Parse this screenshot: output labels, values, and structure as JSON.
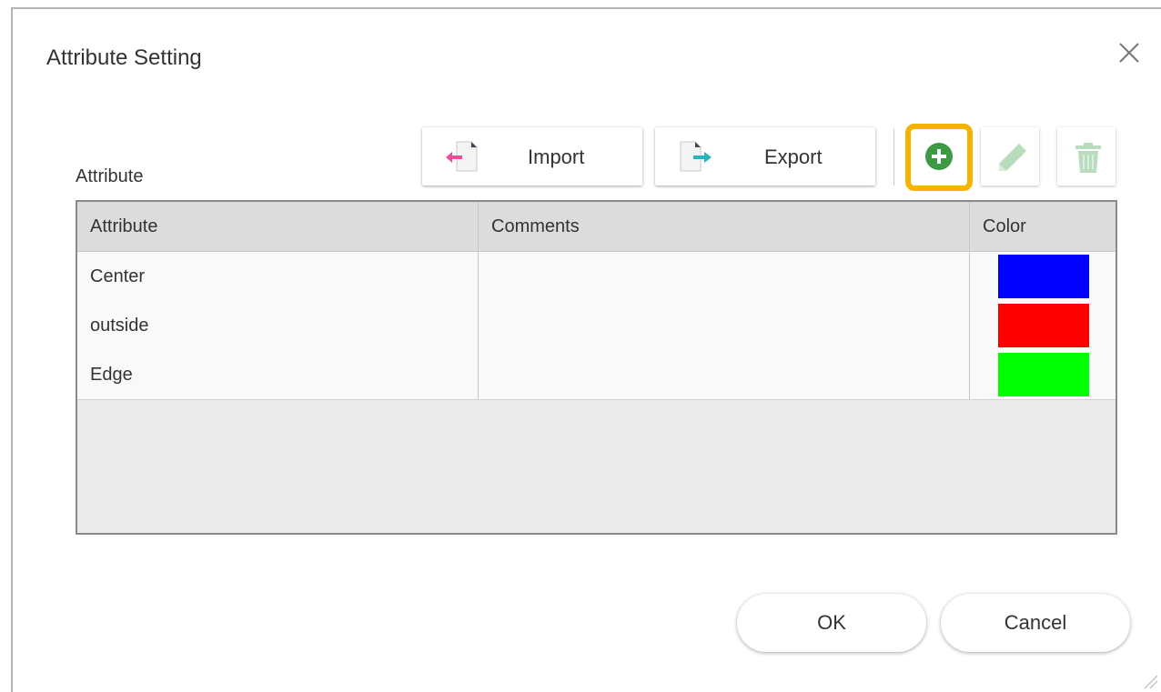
{
  "dialog": {
    "title": "Attribute Setting",
    "close_icon": "close-icon"
  },
  "section_label": "Attribute",
  "toolbar": {
    "import_label": "Import",
    "export_label": "Export",
    "import_icon": "import-file-icon",
    "export_icon": "export-file-icon",
    "add_icon": "add-circle-icon",
    "edit_icon": "pencil-icon",
    "delete_icon": "trash-icon",
    "add_color": "#3c9a45",
    "highlight_color": "#f4b400"
  },
  "table": {
    "headers": [
      "Attribute",
      "Comments",
      "Color"
    ],
    "rows": [
      {
        "attribute": "Center",
        "comments": "",
        "color": "#0000ff"
      },
      {
        "attribute": "outside",
        "comments": "",
        "color": "#ff0000"
      },
      {
        "attribute": "Edge",
        "comments": "",
        "color": "#00ff00"
      }
    ]
  },
  "footer": {
    "ok_label": "OK",
    "cancel_label": "Cancel"
  }
}
